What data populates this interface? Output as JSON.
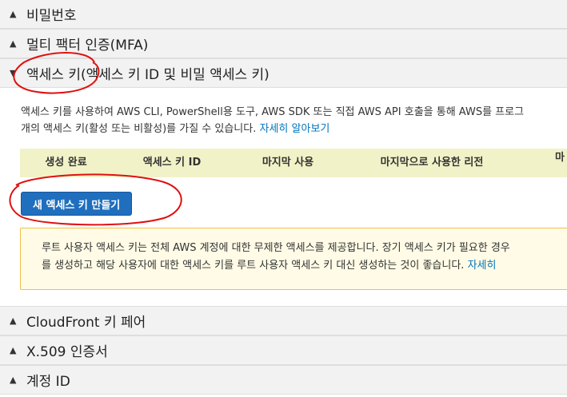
{
  "sections": {
    "password": {
      "label": "비밀번호",
      "icon": "triangle-up-icon"
    },
    "mfa": {
      "label": "멀티 팩터 인증(MFA)",
      "icon": "triangle-up-icon"
    },
    "access_keys": {
      "label": "액세스 키(액세스 키 ID 및 비밀 액세스 키)",
      "icon": "triangle-down-icon"
    },
    "cloudfront": {
      "label": "CloudFront 키 페어",
      "icon": "triangle-up-icon"
    },
    "x509": {
      "label": "X.509 인증서",
      "icon": "triangle-up-icon"
    },
    "account_id": {
      "label": "계정 ID",
      "icon": "triangle-up-icon"
    }
  },
  "access_keys_panel": {
    "description_line1": "액세스 키를 사용하여 AWS CLI, PowerShell용 도구, AWS SDK 또는 직접 AWS API 호출을 통해 AWS를 프로그",
    "description_line2": "개의 액세스 키(활성 또는 비활성)를 가질 수 있습니다.",
    "learn_more_link": "자세히 알아보기",
    "table_headers": [
      "생성 완료",
      "액세스 키 ID",
      "마지막 사용",
      "마지막으로 사용한 리전",
      "마"
    ],
    "create_button": "새 액세스 키 만들기",
    "warning_line1": "루트 사용자 액세스 키는 전체 AWS 계정에 대한 무제한 액세스를 제공합니다. 장기 액세스 키가 필요한 경우",
    "warning_line2": "를 생성하고 해당 사용자에 대한 액세스 키를 루트 사용자 액세스 키 대신 생성하는 것이 좋습니다.",
    "warning_link": "자세히"
  },
  "colors": {
    "header_bg": "#f2f2f2",
    "table_header_bg": "#f2f2c8",
    "primary_button": "#1f6fbe",
    "link": "#0073bb",
    "warning_bg": "#fffbe6",
    "warning_border": "#f0c04a",
    "annotation": "#e01010"
  }
}
